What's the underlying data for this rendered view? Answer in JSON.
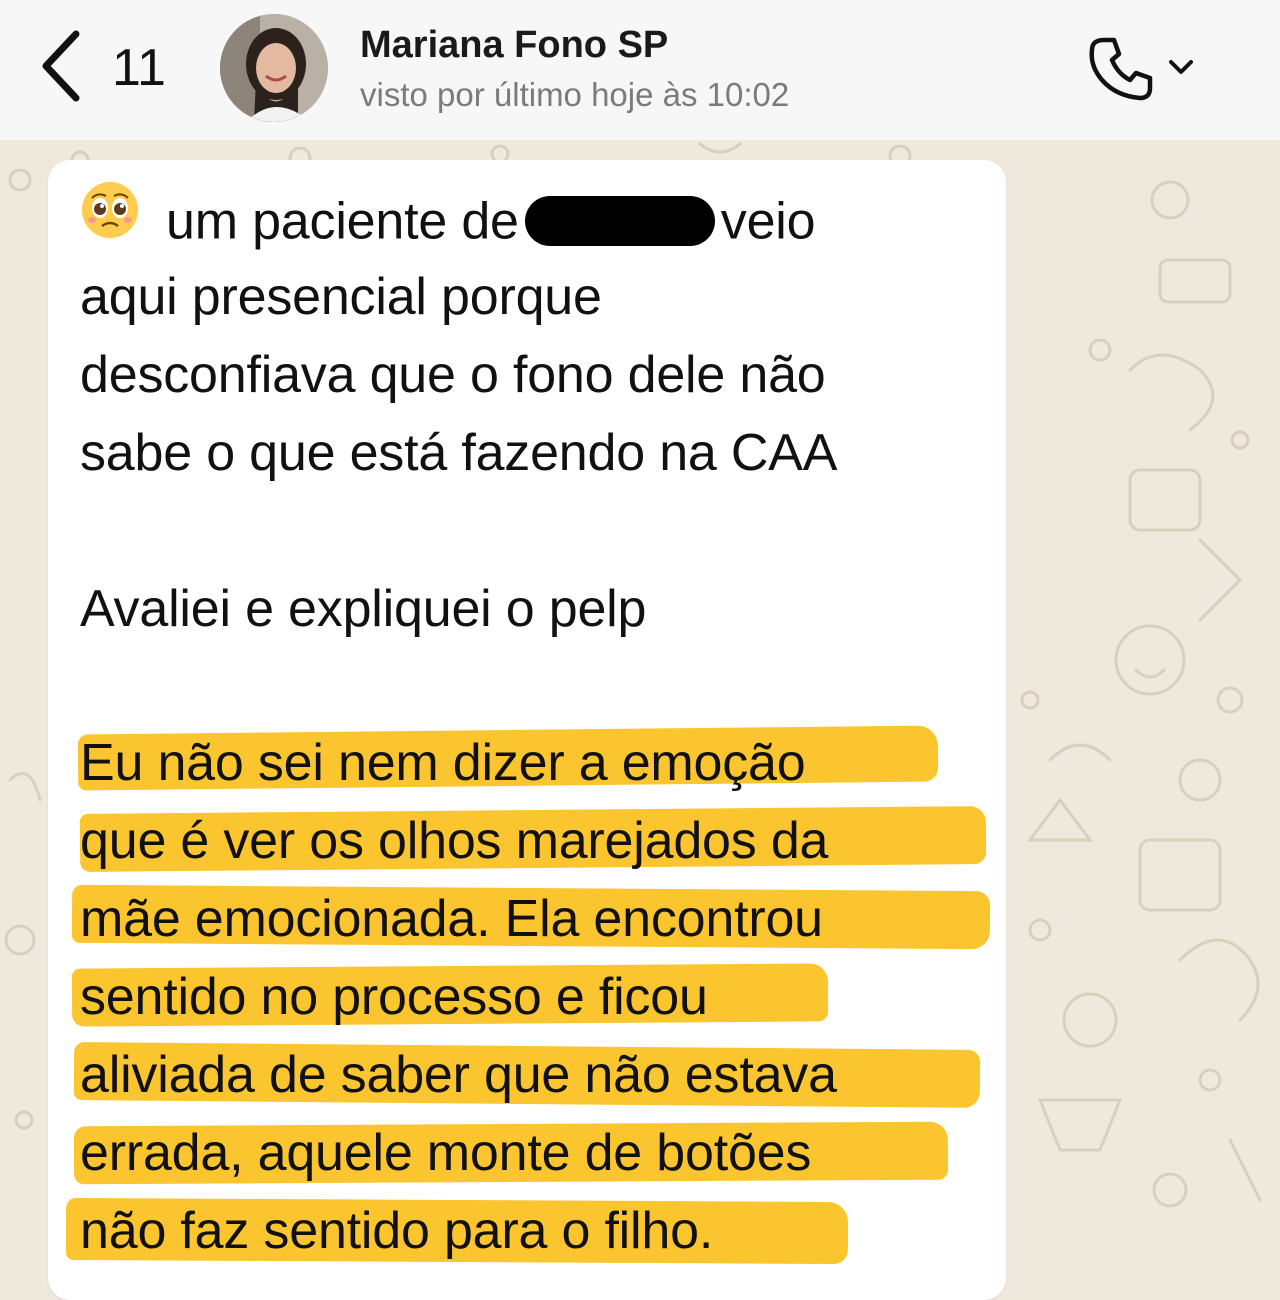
{
  "header": {
    "back_count": "11",
    "contact_name": "Mariana Fono SP",
    "contact_status": "visto por último hoje às 10:02"
  },
  "message": {
    "emoji": "pleading-face-emoji",
    "line1_before": "um paciente de",
    "line1_after": "veio",
    "line2": "aqui presencial porque",
    "line3": "desconfiava que o fono dele não",
    "line4": "sabe o que está fazendo na CAA",
    "line5": "Avaliei e expliquei o pelp",
    "highlighted": [
      "Eu não sei nem dizer a emoção",
      "que é ver os olhos marejados da",
      "mãe emocionada. Ela encontrou",
      "sentido no processo e ficou",
      "aliviada de saber que não estava",
      "errada, aquele monte de botões",
      "não faz sentido para o filho."
    ]
  },
  "colors": {
    "chat_background": "#efe9dd",
    "bubble": "#ffffff",
    "highlight": "#fbc52f",
    "header": "#f7f7f7"
  }
}
